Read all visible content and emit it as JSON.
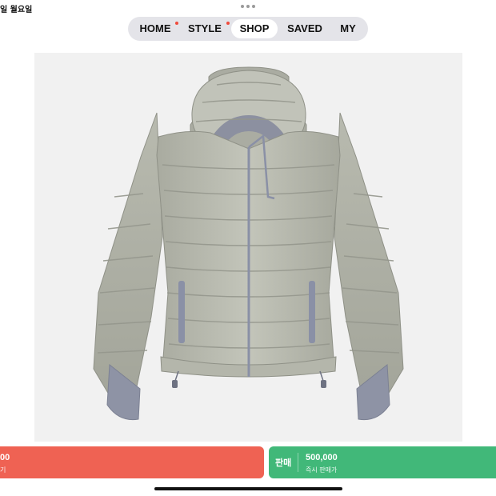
{
  "status_bar": {
    "date_text": "일 월요일"
  },
  "nav": {
    "tabs": [
      {
        "label": "HOME",
        "has_badge": true
      },
      {
        "label": "STYLE",
        "has_badge": true
      },
      {
        "label": "SHOP",
        "active": true
      },
      {
        "label": "SAVED"
      },
      {
        "label": "MY"
      }
    ]
  },
  "product": {
    "image_alt": "light grey-green hooded quilted puffer jacket"
  },
  "buy": {
    "price": "00",
    "sub": "기"
  },
  "sell": {
    "label": "판매",
    "price": "500,000",
    "sub": "즉시 판매가"
  },
  "colors": {
    "buy": "#ef6253",
    "sell": "#41b879",
    "badge": "#f04a3c",
    "tabbar": "#e4e4e9",
    "image_bg": "#f1f1f1"
  }
}
